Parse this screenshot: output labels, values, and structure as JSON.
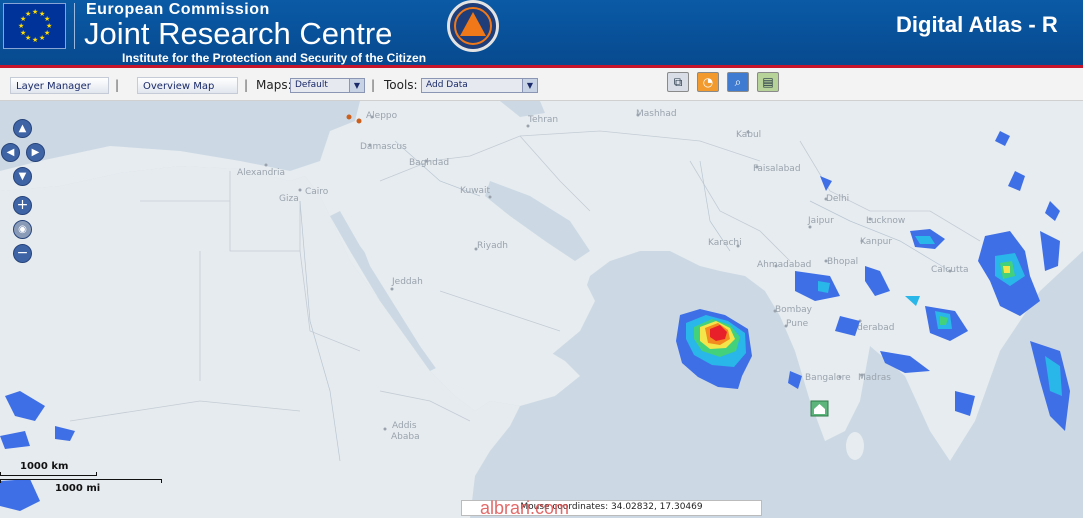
{
  "header": {
    "org": "European Commission",
    "title": "Joint Research Centre",
    "institute": "Institute for the Protection and Security of the Citizen",
    "app_title": "Digital Atlas - R"
  },
  "toolbar": {
    "layer_manager": "Layer Manager",
    "overview_map": "Overview Map",
    "maps_label": "Maps:",
    "maps_value": "Default",
    "tools_label": "Tools:",
    "tools_value": "Add Data",
    "separator": "|",
    "icons": [
      "copy-icon",
      "rss-icon",
      "zoom-search-icon",
      "export-icon"
    ]
  },
  "map": {
    "cities": [
      "Aleppo",
      "Tehran",
      "Mashhad",
      "Kabul",
      "Faisalabad",
      "Damascus",
      "Baghdad",
      "Alexandria",
      "Cairo",
      "Giza",
      "Kuwait",
      "Delhi",
      "Jaipur",
      "Lucknow",
      "Kanpur",
      "Riyadh",
      "Karachi",
      "Ahmadabad",
      "Bhopal",
      "Calcutta",
      "Jeddah",
      "Bombay",
      "Pune",
      "Hyderabad",
      "Bangalore",
      "Madras",
      "Addis Ababa"
    ],
    "scale_km": "1000 km",
    "scale_mi": "1000 mi",
    "coordinates": "Mouse coordinates: 34.02832, 17.30469",
    "watermark": "albrari.com",
    "cyclone_colors": [
      "#3f6fe6",
      "#29b6e9",
      "#43d17c",
      "#f4e64a",
      "#f38b1f",
      "#e8202a"
    ]
  }
}
